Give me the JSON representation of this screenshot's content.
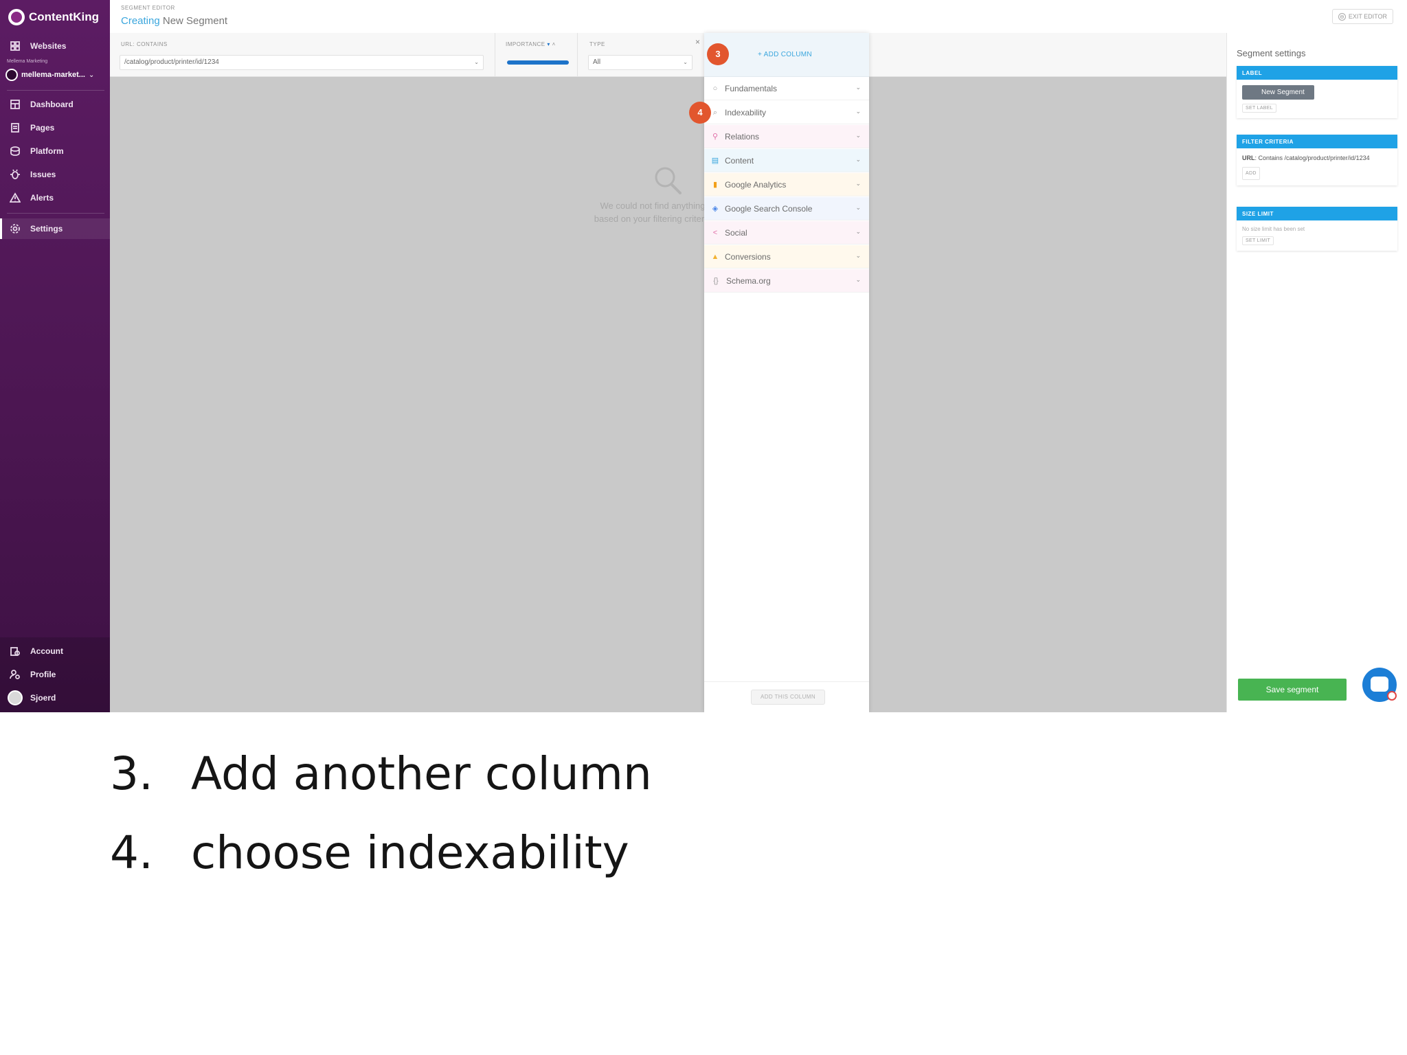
{
  "sidebar": {
    "brand": "ContentKing",
    "websites_label": "Websites",
    "account_hint": "Mellema Marketing",
    "account_name": "mellema-market...",
    "account_chevron": "⌄",
    "nav": [
      {
        "label": "Dashboard"
      },
      {
        "label": "Pages"
      },
      {
        "label": "Platform"
      },
      {
        "label": "Issues"
      },
      {
        "label": "Alerts"
      },
      {
        "label": "Settings"
      }
    ],
    "bottom": [
      {
        "label": "Account"
      },
      {
        "label": "Profile"
      },
      {
        "label": "Sjoerd"
      }
    ]
  },
  "header": {
    "small_label": "SEGMENT EDITOR",
    "title_prefix": "Creating",
    "title_rest": " New Segment",
    "exit_label": "EXIT EDITOR",
    "exit_icon": "⊖"
  },
  "filters": {
    "url_header": "URL: CONTAINS",
    "url_value": "/catalog/product/printer/id/1234",
    "importance_header": "IMPORTANCE",
    "type_header": "TYPE",
    "type_value": "All",
    "arrow": "⌄",
    "close": "×"
  },
  "empty_state": {
    "text": "We could not find anything based on your filtering criteria"
  },
  "add_column": {
    "link_label": "+ ADD COLUMN",
    "categories": [
      {
        "label": "Fundamentals",
        "icon": "○",
        "color": "#9a9a9a",
        "bg": "#ffffff"
      },
      {
        "label": "Indexability",
        "icon": "⌕",
        "color": "#9a9a9a",
        "bg": "#ffffff"
      },
      {
        "label": "Relations",
        "icon": "⚲",
        "color": "#e06fa8",
        "bg": "#fdf3f8"
      },
      {
        "label": "Content",
        "icon": "▤",
        "color": "#3aa6dd",
        "bg": "#eef7fc"
      },
      {
        "label": "Google Analytics",
        "icon": "▮",
        "color": "#f2a019",
        "bg": "#fff8ec"
      },
      {
        "label": "Google Search Console",
        "icon": "◈",
        "color": "#4a86e8",
        "bg": "#f1f5fd"
      },
      {
        "label": "Social",
        "icon": "<",
        "color": "#e06fa8",
        "bg": "#fdf3f8"
      },
      {
        "label": "Conversions",
        "icon": "▲",
        "color": "#f2b233",
        "bg": "#fff9ed"
      },
      {
        "label": "Schema.org",
        "icon": "{}",
        "color": "#9a9a9a",
        "bg": "#fdf3f8"
      }
    ],
    "chevron": "⌄",
    "footer_button": "ADD THIS COLUMN"
  },
  "settings_panel": {
    "title": "Segment settings",
    "label_card": {
      "header": "LABEL",
      "pill": "New Segment",
      "button": "SET LABEL"
    },
    "filter_card": {
      "header": "FILTER CRITERIA",
      "key": "URL",
      "text": ": Contains /catalog/product/printer/id/1234",
      "button": "ADD"
    },
    "size_card": {
      "header": "SIZE LIMIT",
      "text": "No size limit has been set",
      "button": "SET LIMIT"
    },
    "save_label": "Save segment"
  },
  "markers": {
    "step3": "3",
    "step4": "4"
  },
  "caption": [
    {
      "num": "3.",
      "text": "Add another column"
    },
    {
      "num": "4.",
      "text": "choose indexability"
    }
  ],
  "colors": {
    "sidebar": "#5c1c63",
    "accent_blue": "#1fa2e6",
    "link_blue": "#3aa6dd",
    "save_green": "#48b452",
    "marker_orange": "#e2562e"
  }
}
